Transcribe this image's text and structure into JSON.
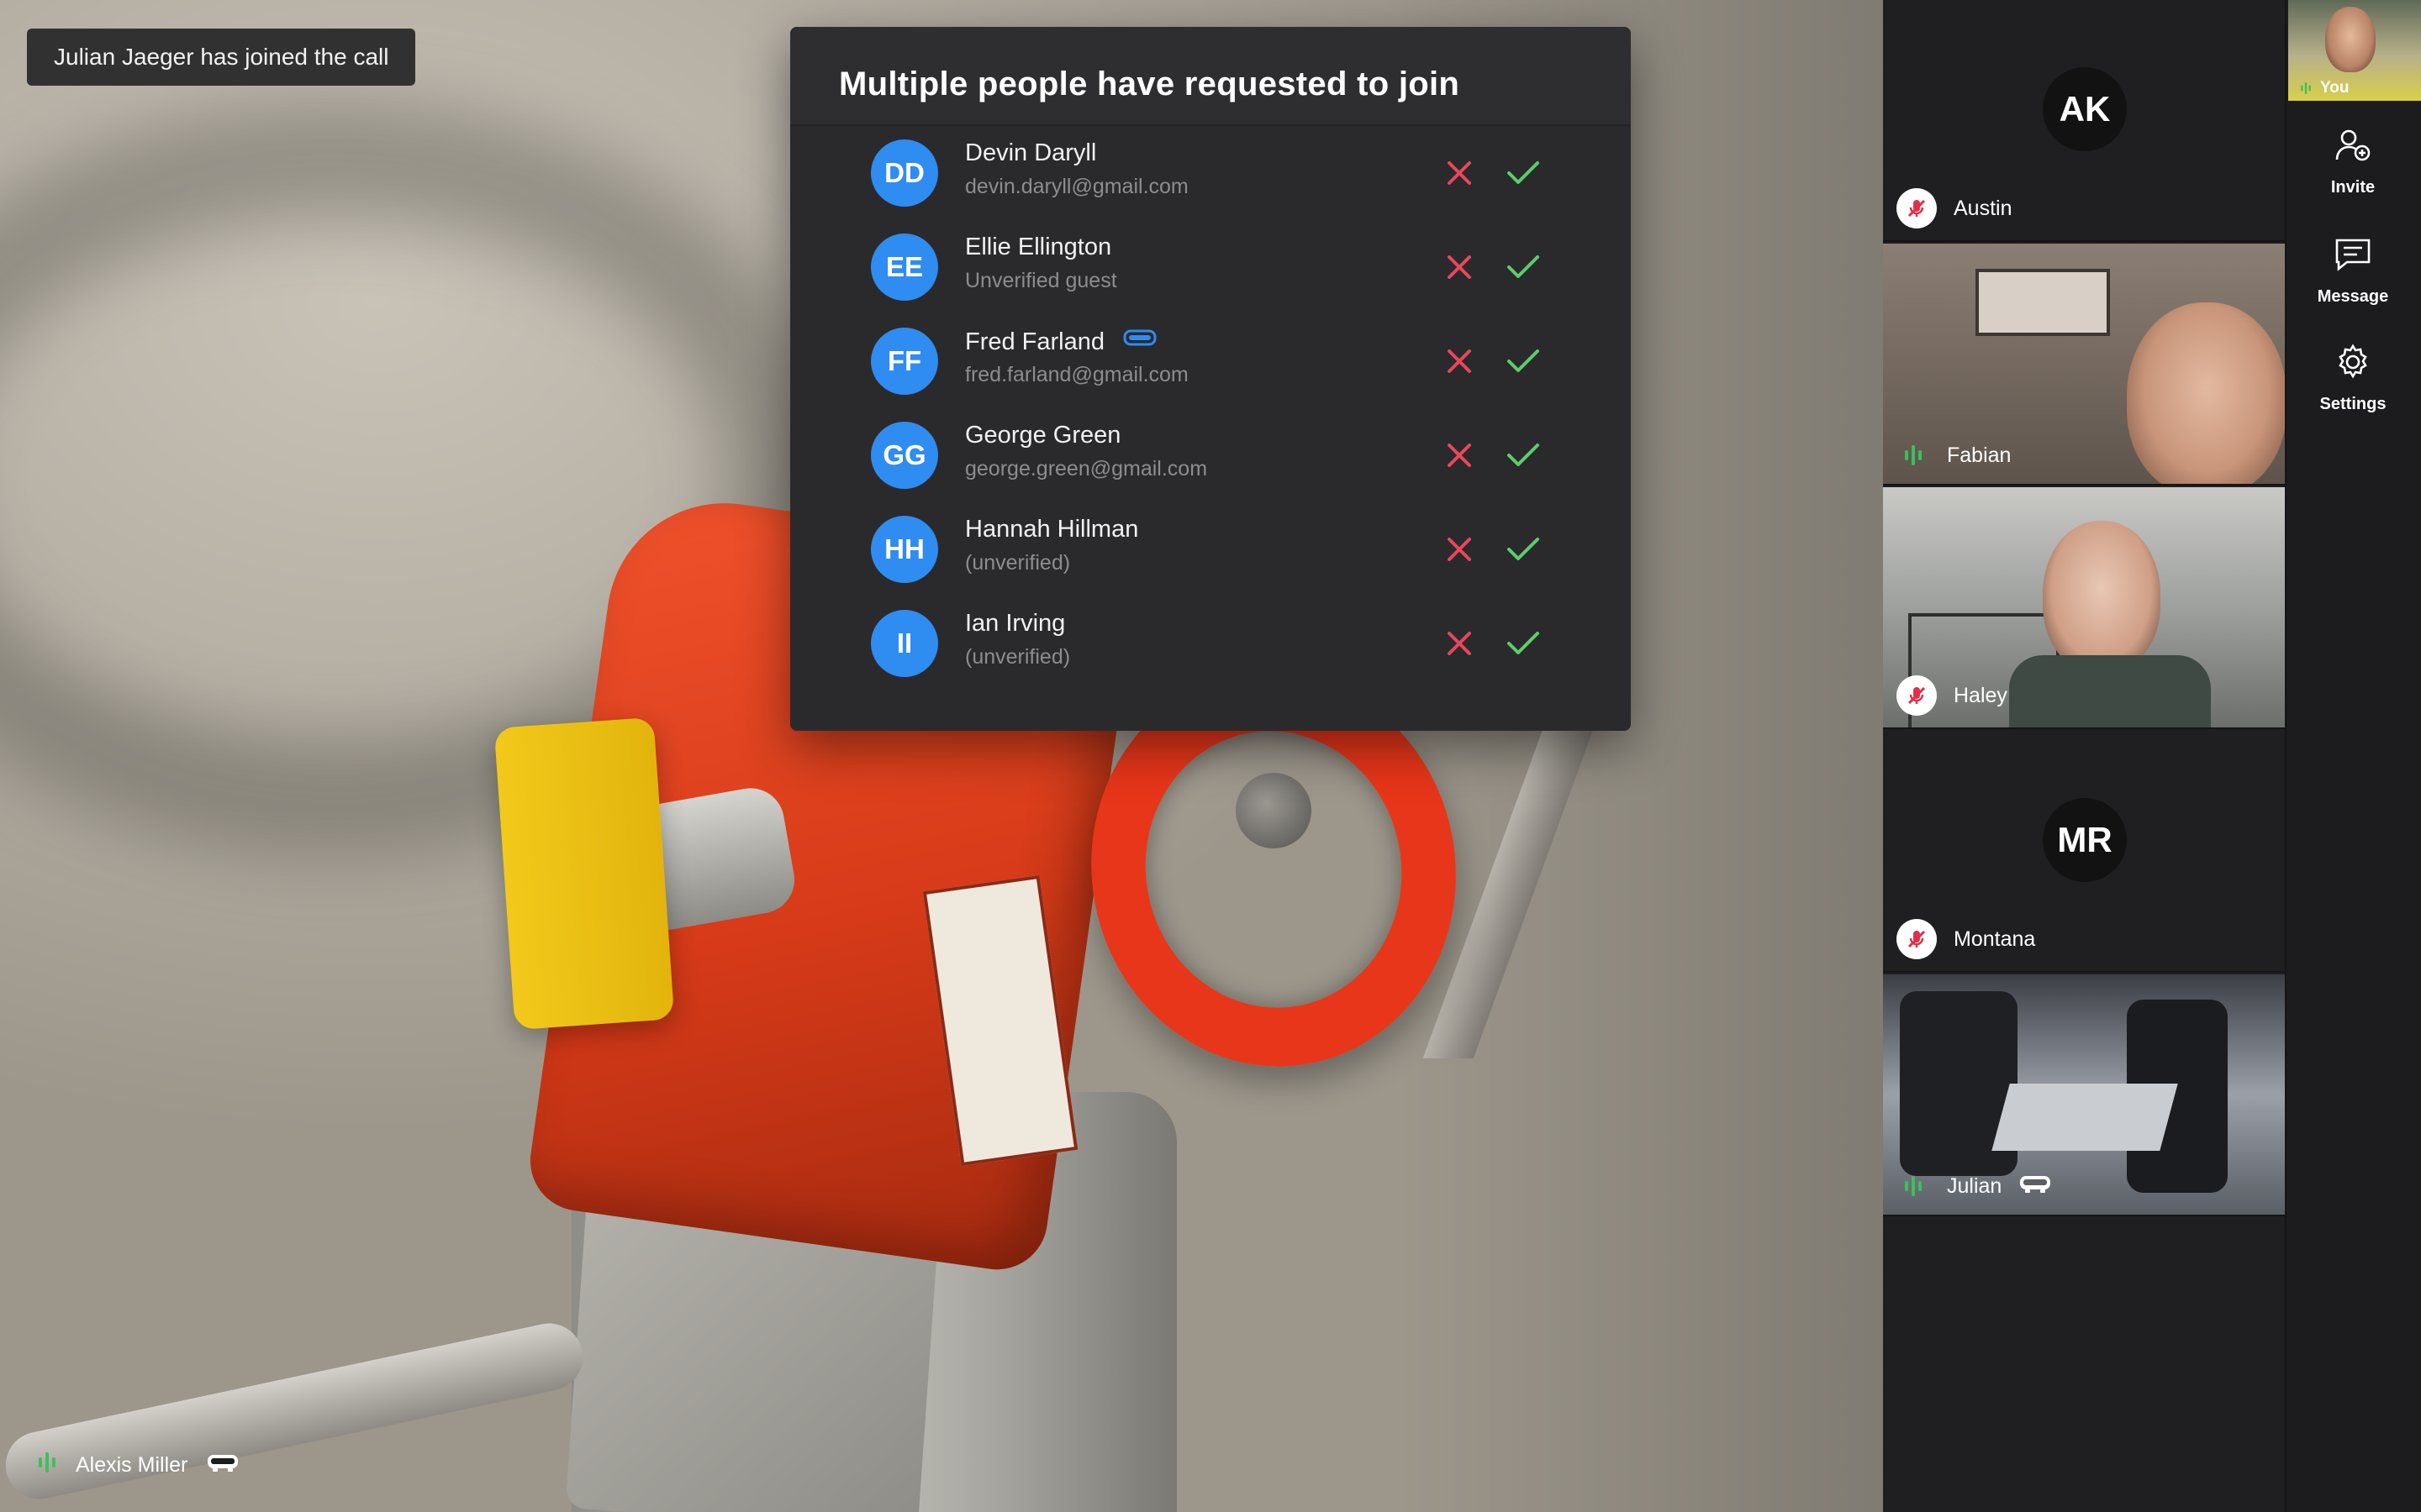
{
  "toast": {
    "text": "Julian Jaeger has joined the call"
  },
  "stage": {
    "participant_name": "Alexis Miller"
  },
  "dialog": {
    "title": "Multiple people have requested to join",
    "requests": [
      {
        "initials": "DD",
        "name": "Devin Daryll",
        "detail": "devin.daryll@gmail.com",
        "headset": false
      },
      {
        "initials": "EE",
        "name": "Ellie Ellington",
        "detail": "Unverified guest",
        "headset": false
      },
      {
        "initials": "FF",
        "name": "Fred Farland",
        "detail": "fred.farland@gmail.com",
        "headset": true
      },
      {
        "initials": "GG",
        "name": "George Green",
        "detail": "george.green@gmail.com",
        "headset": false
      },
      {
        "initials": "HH",
        "name": "Hannah Hillman",
        "detail": "(unverified)",
        "headset": false
      },
      {
        "initials": "II",
        "name": "Ian Irving",
        "detail": "(unverified)",
        "headset": false
      }
    ]
  },
  "participants": [
    {
      "name": "Austin",
      "initials": "AK",
      "video": false,
      "muted": true
    },
    {
      "name": "Fabian",
      "initials": "",
      "video": true,
      "muted": false
    },
    {
      "name": "Haley",
      "initials": "",
      "video": true,
      "muted": true
    },
    {
      "name": "Montana",
      "initials": "MR",
      "video": false,
      "muted": true
    },
    {
      "name": "Julian",
      "initials": "",
      "video": true,
      "muted": false,
      "headset": true
    }
  ],
  "self": {
    "label": "You"
  },
  "rail": {
    "invite": "Invite",
    "message": "Message",
    "settings": "Settings"
  },
  "colors": {
    "accent_blue": "#2f8cf0",
    "deny_red": "#e8475b",
    "accept_green": "#5ccd6a",
    "mute_red": "#e0304a",
    "speaking_green": "#3fbf5a"
  }
}
